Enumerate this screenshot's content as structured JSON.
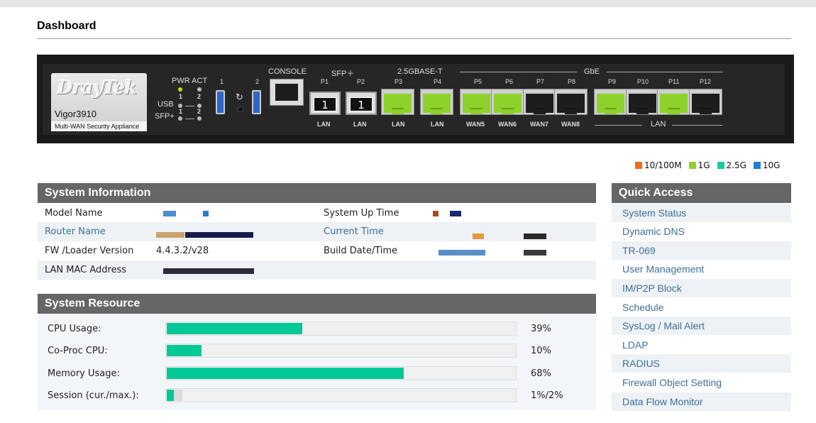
{
  "page": {
    "title": "Dashboard"
  },
  "device": {
    "brand": "DrayTek",
    "model": "Vigor3910",
    "subtitle": "Multi-WAN Security Appliance",
    "pwr_act": "PWR ACT",
    "usb": "USB",
    "sfp_plus_led": "SFP+",
    "led_numbers": [
      "1",
      "2",
      "1",
      "2"
    ],
    "usb_port_numbers": [
      "1",
      "2"
    ],
    "console": "CONSOLE",
    "sfp_group": "SFP＋",
    "base_group": "2.5GBASE-T",
    "gbe_group": "GbE",
    "ports": [
      {
        "name": "P1",
        "label": "LAN"
      },
      {
        "name": "P2",
        "label": "LAN"
      },
      {
        "name": "P3",
        "label": "LAN"
      },
      {
        "name": "P4",
        "label": "LAN"
      },
      {
        "name": "P5",
        "label": "WAN5"
      },
      {
        "name": "P6",
        "label": "WAN6"
      },
      {
        "name": "P7",
        "label": "WAN7"
      },
      {
        "name": "P8",
        "label": "WAN8"
      },
      {
        "name": "P9",
        "label": ""
      },
      {
        "name": "P10",
        "label": ""
      },
      {
        "name": "P11",
        "label": ""
      },
      {
        "name": "P12",
        "label": ""
      }
    ],
    "lan_group": "LAN",
    "sfp_module_digit": "1"
  },
  "legend": [
    {
      "label": "10/100M",
      "color": "#f26a1b"
    },
    {
      "label": "1G",
      "color": "#8dd22a"
    },
    {
      "label": "2.5G",
      "color": "#19c9a0"
    },
    {
      "label": "10G",
      "color": "#1f7fd6"
    }
  ],
  "system_information": {
    "title": "System Information",
    "model_name_label": "Model Name",
    "router_name_label": "Router Name",
    "fw_label": "FW /Loader Version",
    "fw_value": "4.4.3.2/v28",
    "lan_mac_label": "LAN MAC Address",
    "uptime_label": "System Up Time",
    "current_time_label": "Current Time",
    "build_label": "Build Date/Time"
  },
  "system_resource": {
    "title": "System Resource",
    "rows": [
      {
        "label": "CPU Usage:",
        "value": "39%",
        "fill": 0.39
      },
      {
        "label": "Co-Proc CPU:",
        "value": "10%",
        "fill": 0.1
      },
      {
        "label": "Memory Usage:",
        "value": "68%",
        "fill": 0.68
      },
      {
        "label": "Session (cur./max.):",
        "value": "1%/2%",
        "fill": 0.01,
        "max": 0.02
      }
    ]
  },
  "quick_access": {
    "title": "Quick Access",
    "items": [
      "System Status",
      "Dynamic DNS",
      "TR-069",
      "User Management",
      "IM/P2P Block",
      "Schedule",
      "SysLog / Mail Alert",
      "LDAP",
      "RADIUS",
      "Firewall Object Setting",
      "Data Flow Monitor"
    ]
  },
  "colors": {
    "panel_header": "#666666",
    "bar_fill": "#00c896",
    "link": "#3e6e98"
  }
}
